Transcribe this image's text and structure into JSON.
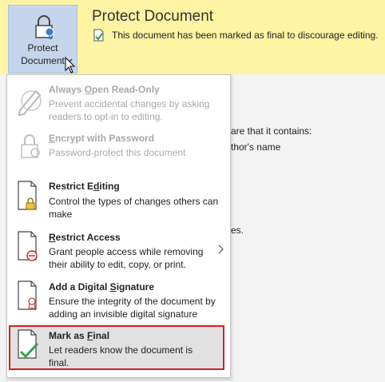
{
  "banner": {
    "button_line1": "Protect",
    "button_line2": "Document",
    "title": "Protect Document",
    "message": "This document has been marked as final to discourage editing."
  },
  "background": {
    "line1": "are that it contains:",
    "line2": "thor's name",
    "line3": "es."
  },
  "menu": {
    "items": [
      {
        "title_pre": "Always ",
        "title_u": "O",
        "title_post": "pen Read-Only",
        "desc": "Prevent accidental changes by asking readers to opt-in to editing.",
        "enabled": false,
        "icon": "pencil-disabled-icon"
      },
      {
        "title_pre": "",
        "title_u": "E",
        "title_post": "ncrypt with Password",
        "desc": "Password-protect this document",
        "enabled": false,
        "icon": "lock-key-icon"
      },
      {
        "title_pre": "Restrict E",
        "title_u": "d",
        "title_post": "iting",
        "desc": "Control the types of changes others can make",
        "enabled": true,
        "icon": "document-lock-icon"
      },
      {
        "title_pre": "",
        "title_u": "R",
        "title_post": "estrict Access",
        "desc": "Grant people access while removing their ability to edit, copy, or print.",
        "enabled": true,
        "icon": "document-restrict-icon"
      },
      {
        "title_pre": "Add a Digital ",
        "title_u": "S",
        "title_post": "ignature",
        "desc": "Ensure the integrity of the document by adding an invisible digital signature",
        "enabled": true,
        "icon": "document-ribbon-icon"
      },
      {
        "title_pre": "Mark as ",
        "title_u": "F",
        "title_post": "inal",
        "desc": "Let readers know the document is final.",
        "enabled": true,
        "icon": "document-check-icon"
      }
    ]
  },
  "colors": {
    "banner_bg": "#fef4a3",
    "button_bg": "#c5d6ec",
    "highlight_border": "#d31f27",
    "selected_bg": "#e1e1e1"
  }
}
